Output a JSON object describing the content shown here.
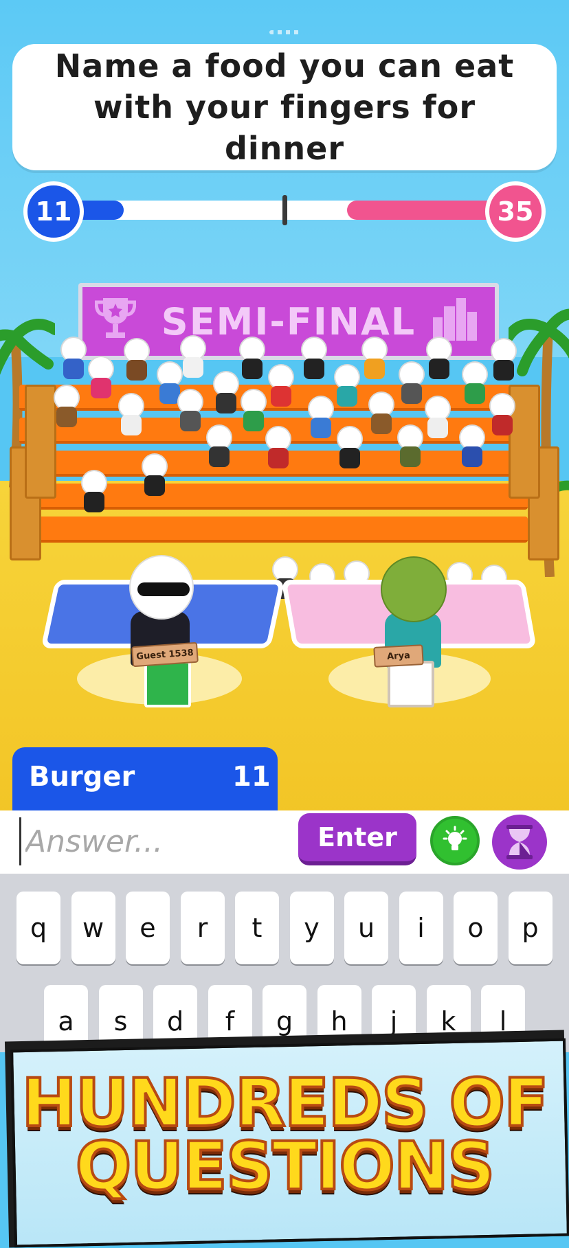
{
  "question": "Name a food you can eat with your fingers for dinner",
  "score": {
    "left": "11",
    "right": "35"
  },
  "banner": {
    "label": "SEMI-FINAL",
    "left_icon": "trophy-icon",
    "right_icon": "city-icon"
  },
  "players": {
    "left_name": "Guest 1538",
    "right_name": "Arya"
  },
  "last_answer": {
    "word": "Burger",
    "count": "11"
  },
  "input": {
    "placeholder": "Answer...",
    "value": ""
  },
  "buttons": {
    "enter": "Enter",
    "hint_icon": "lightbulb-icon",
    "time_icon": "hourglass-icon"
  },
  "keyboard": {
    "row1": [
      "q",
      "w",
      "e",
      "r",
      "t",
      "y",
      "u",
      "i",
      "o",
      "p"
    ],
    "row2": [
      "a",
      "s",
      "d",
      "f",
      "g",
      "h",
      "j",
      "k",
      "l"
    ]
  },
  "promo": {
    "line1": "HUNDREDS OF",
    "line2": "QUESTIONS"
  },
  "colors": {
    "blue": "#1b56e8",
    "pink": "#f1548f",
    "purple": "#9b34c9",
    "green": "#31c030"
  }
}
